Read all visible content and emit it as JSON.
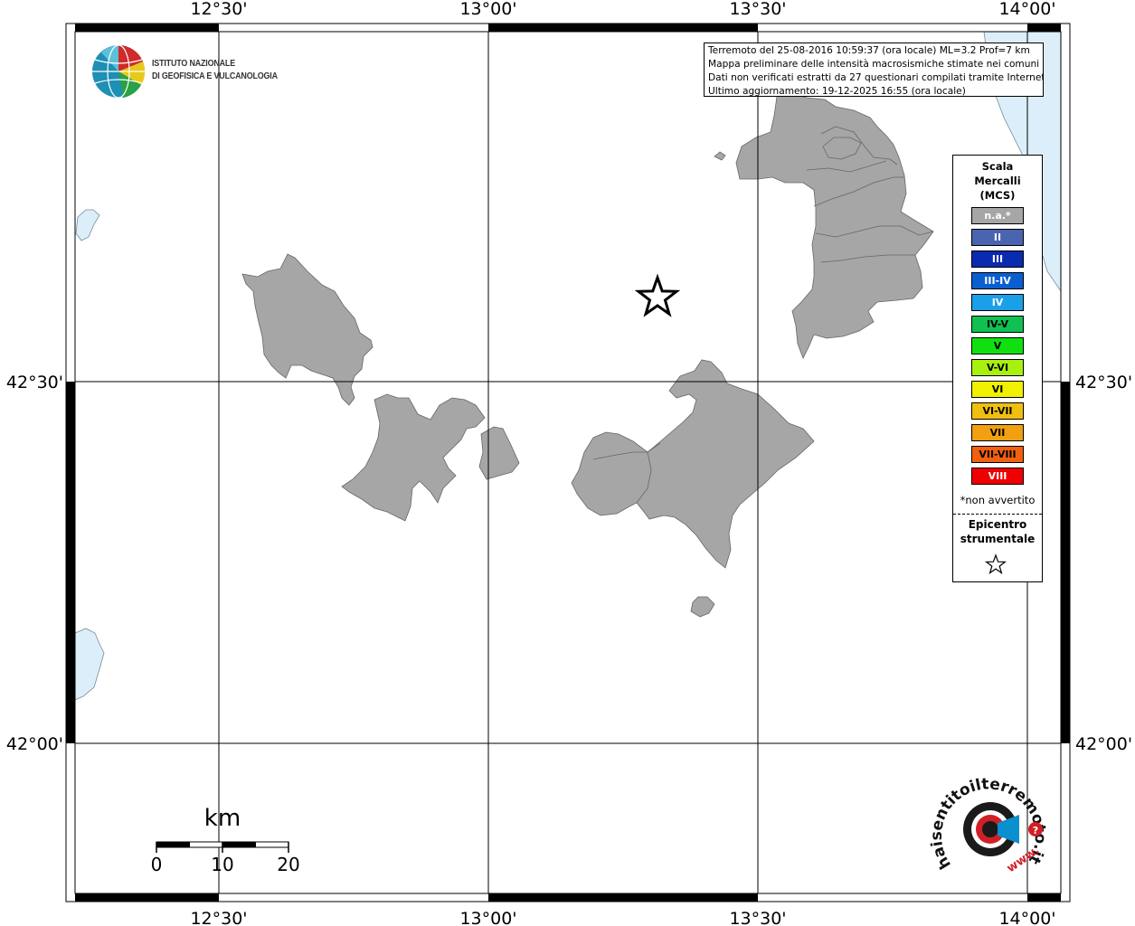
{
  "map": {
    "x_ticks": [
      "12°30'",
      "13°00'",
      "13°30'",
      "14°00'"
    ],
    "y_ticks": [
      "42°30'",
      "42°00'"
    ],
    "land_color": "#a6a6a6",
    "sea_color": "#dbeefa",
    "border_color": "#000000"
  },
  "info": {
    "line1": "Terremoto del 25-08-2016 10:59:37 (ora locale) ML=3.2 Prof=7 km",
    "line2": "Mappa preliminare delle intensità macrosismiche stimate nei comuni",
    "line3": "Dati non verificati estratti da 27 questionari compilati tramite Internet.",
    "line4": "Ultimo aggiornamento: 19-12-2025 16:55 (ora locale)"
  },
  "legend": {
    "title_line1": "Scala",
    "title_line2": "Mercalli",
    "title_line3": "(MCS)",
    "items": [
      {
        "label": "n.a.*",
        "color": "#a6a6a6",
        "dark": false
      },
      {
        "label": "II",
        "color": "#4a64b0",
        "dark": false
      },
      {
        "label": "III",
        "color": "#0a2bb0",
        "dark": false
      },
      {
        "label": "III-IV",
        "color": "#0a5fd0",
        "dark": false
      },
      {
        "label": "IV",
        "color": "#1aa0e8",
        "dark": false
      },
      {
        "label": "IV-V",
        "color": "#10c050",
        "dark": true
      },
      {
        "label": "V",
        "color": "#10e010",
        "dark": true
      },
      {
        "label": "V-VI",
        "color": "#a8f010",
        "dark": true
      },
      {
        "label": "VI",
        "color": "#f0f000",
        "dark": true
      },
      {
        "label": "VI-VII",
        "color": "#f0c010",
        "dark": true
      },
      {
        "label": "VII",
        "color": "#f0a010",
        "dark": true
      },
      {
        "label": "VII-VIII",
        "color": "#f06010",
        "dark": true
      },
      {
        "label": "VIII",
        "color": "#f00000",
        "dark": false
      }
    ],
    "note": "*non avvertito",
    "epicenter_line1": "Epicentro",
    "epicenter_line2": "strumentale"
  },
  "scale_bar": {
    "unit": "km",
    "labels": [
      "0",
      "10",
      "20"
    ]
  },
  "logos": {
    "ingv_line1": "ISTITUTO NAZIONALE",
    "ingv_line2": "DI GEOFISICA E VULCANOLOGIA",
    "hai_text": "haisentitoilterremoto.it",
    "hai_www": "www."
  }
}
